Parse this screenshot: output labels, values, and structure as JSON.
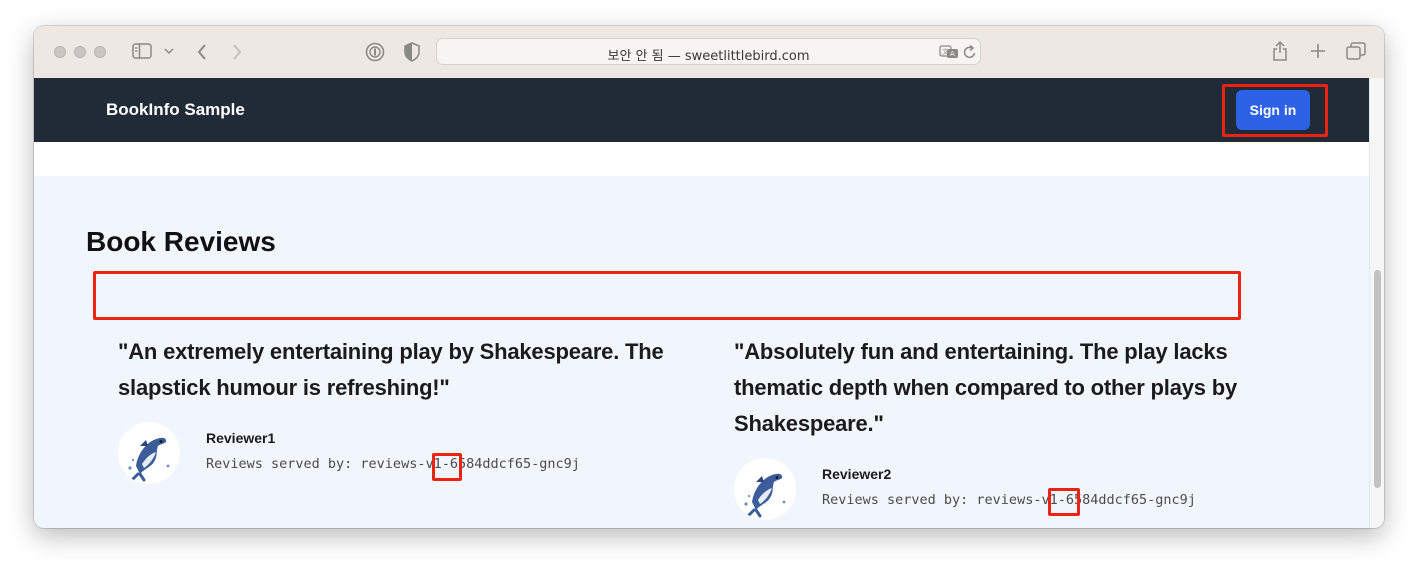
{
  "browser": {
    "url_text": "보안 안 됨 — sweetlittlebird.com",
    "icons": [
      "sidebar-icon",
      "chevron-down-icon",
      "back-icon",
      "forward-icon",
      "password-icon",
      "shield-icon",
      "translate-icon",
      "reload-icon",
      "share-icon",
      "new-tab-icon",
      "tabs-overview-icon"
    ]
  },
  "app": {
    "brand": "BookInfo Sample",
    "signin_label": "Sign in",
    "accent_color": "#2e62e6",
    "navbar_color": "#212b38"
  },
  "reviews_section": {
    "heading": "Book Reviews",
    "reviews": [
      {
        "quote": "\"An extremely entertaining play by Shakespeare. The slapstick humour is refreshing!\"",
        "reviewer": "Reviewer1",
        "served_prefix": "Reviews served by: reviews-",
        "served_version": "v1",
        "served_suffix": "-6584ddcf65-gnc9j"
      },
      {
        "quote": "\"Absolutely fun and entertaining. The play lacks thematic depth when compared to other plays by Shakespeare.\"",
        "reviewer": "Reviewer2",
        "served_prefix": "Reviews served by: reviews-",
        "served_version": "v1",
        "served_suffix": "-6584ddcf65-gnc9j"
      }
    ]
  },
  "annotation_color": "#ee2211"
}
